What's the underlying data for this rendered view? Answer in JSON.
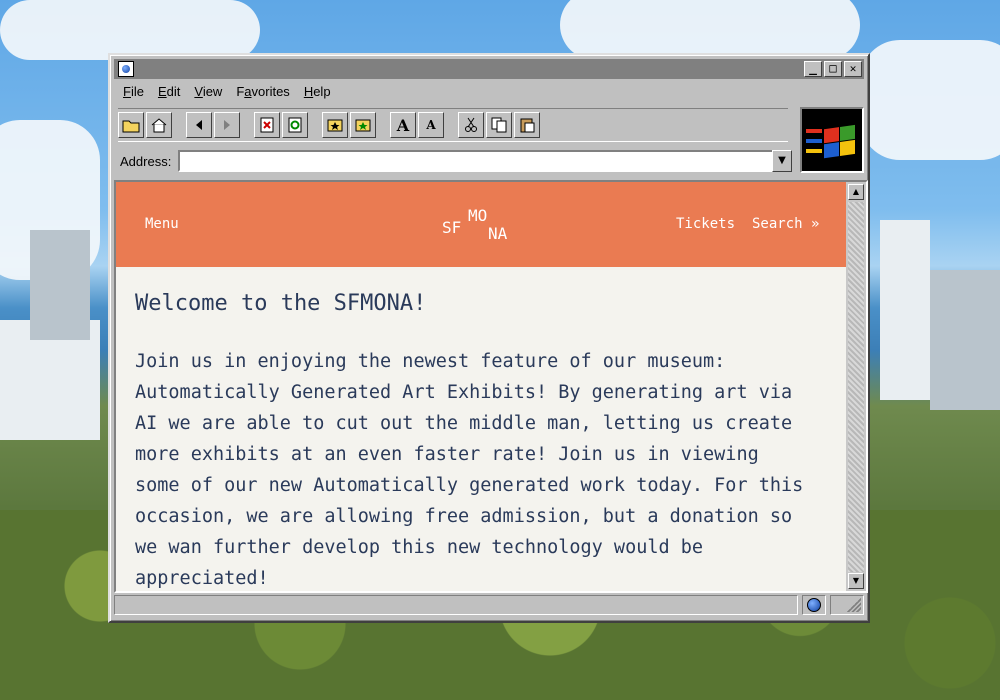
{
  "window": {
    "menu": [
      {
        "pre": "",
        "ul": "F",
        "post": "ile"
      },
      {
        "pre": "",
        "ul": "E",
        "post": "dit"
      },
      {
        "pre": "",
        "ul": "V",
        "post": "iew"
      },
      {
        "pre": "F",
        "ul": "a",
        "post": "vorites"
      },
      {
        "pre": "",
        "ul": "H",
        "post": "elp"
      }
    ],
    "controls": {
      "minimize": "_",
      "maximize": "□",
      "close": "✕"
    },
    "address": {
      "label": "Address:",
      "value": ""
    },
    "toolbar": {
      "icons": [
        "open-folder-icon",
        "home-icon",
        "back-icon",
        "forward-icon",
        "stop-icon",
        "refresh-icon",
        "favorites-icon",
        "history-icon",
        "font-larger-icon",
        "font-smaller-icon",
        "cut-icon",
        "copy-icon",
        "paste-icon"
      ]
    }
  },
  "site": {
    "nav": {
      "menu": "Menu",
      "tickets": "Tickets",
      "search": "Search »"
    },
    "logo": {
      "sf": "SF",
      "mo": "MO",
      "na": "NA"
    },
    "heading": "Welcome to the SFMONA!",
    "body": "Join us in enjoying the newest feature of our museum: Automatically Generated Art Exhibits! By generating art via AI we are able to cut out the middle man, letting us create more exhibits at an even faster rate! Join us in viewing some of our new Automatically generated work today. For this occasion, we are allowing free admission, but a donation so we wan further develop this new technology would be appreciated!",
    "colors": {
      "header": "#ea7b52",
      "text": "#2a3a5a",
      "background": "#f4f3ee"
    }
  }
}
